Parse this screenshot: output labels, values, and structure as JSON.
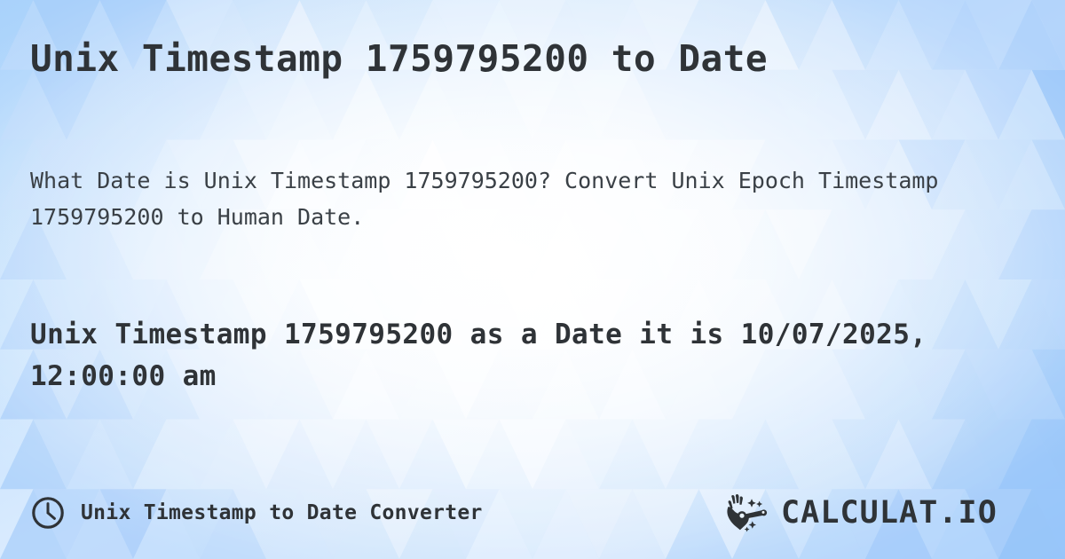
{
  "page": {
    "title": "Unix Timestamp 1759795200 to Date",
    "description": "What Date is Unix Timestamp 1759795200? Convert Unix Epoch Timestamp 1759795200 to Human Date.",
    "result": "Unix Timestamp 1759795200 as a Date it is 10/07/2025, 12:00:00 am"
  },
  "timestamp": {
    "value": "1759795200",
    "human_date": "10/07/2025, 12:00:00 am"
  },
  "footer": {
    "clock_icon": "clock-icon",
    "label": "Unix Timestamp to Date Converter"
  },
  "brand": {
    "wand_icon": "magic-wand-hand-icon",
    "name": "CALCULAT.IO"
  },
  "colors": {
    "text_dark": "#2f3337",
    "text_body": "#3a4046",
    "bg_blue": "#9cc8fa",
    "bg_light": "#eaf4fe",
    "bg_white": "#ffffff"
  }
}
